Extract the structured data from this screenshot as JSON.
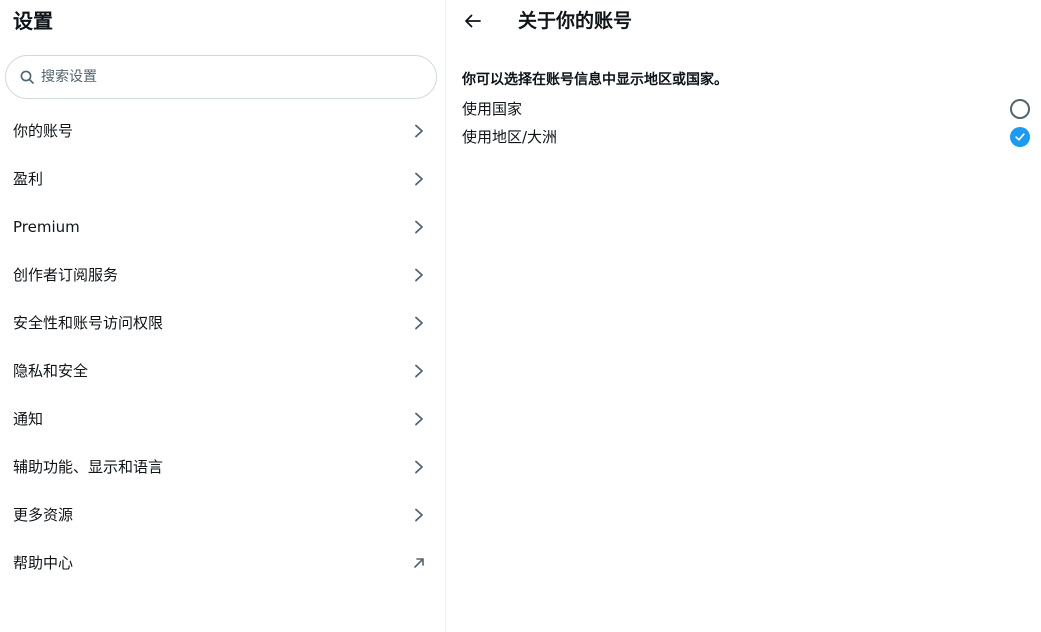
{
  "sidebar": {
    "title": "设置",
    "search": {
      "placeholder": "搜索设置",
      "value": ""
    },
    "items": [
      {
        "label": "你的账号",
        "icon": "chevron-right-icon"
      },
      {
        "label": "盈利",
        "icon": "chevron-right-icon"
      },
      {
        "label": "Premium",
        "icon": "chevron-right-icon"
      },
      {
        "label": "创作者订阅服务",
        "icon": "chevron-right-icon"
      },
      {
        "label": "安全性和账号访问权限",
        "icon": "chevron-right-icon"
      },
      {
        "label": "隐私和安全",
        "icon": "chevron-right-icon"
      },
      {
        "label": "通知",
        "icon": "chevron-right-icon"
      },
      {
        "label": "辅助功能、显示和语言",
        "icon": "chevron-right-icon"
      },
      {
        "label": "更多资源",
        "icon": "chevron-right-icon"
      },
      {
        "label": "帮助中心",
        "icon": "external-link-arrow-icon"
      }
    ]
  },
  "main": {
    "title": "关于你的账号",
    "description": "你可以选择在账号信息中显示地区或国家。",
    "options": [
      {
        "label": "使用国家",
        "selected": false
      },
      {
        "label": "使用地区/大洲",
        "selected": true
      }
    ]
  },
  "colors": {
    "accent": "#1d9bf0",
    "text": "#0f1419",
    "secondary": "#536471",
    "border": "#cfd9de"
  }
}
